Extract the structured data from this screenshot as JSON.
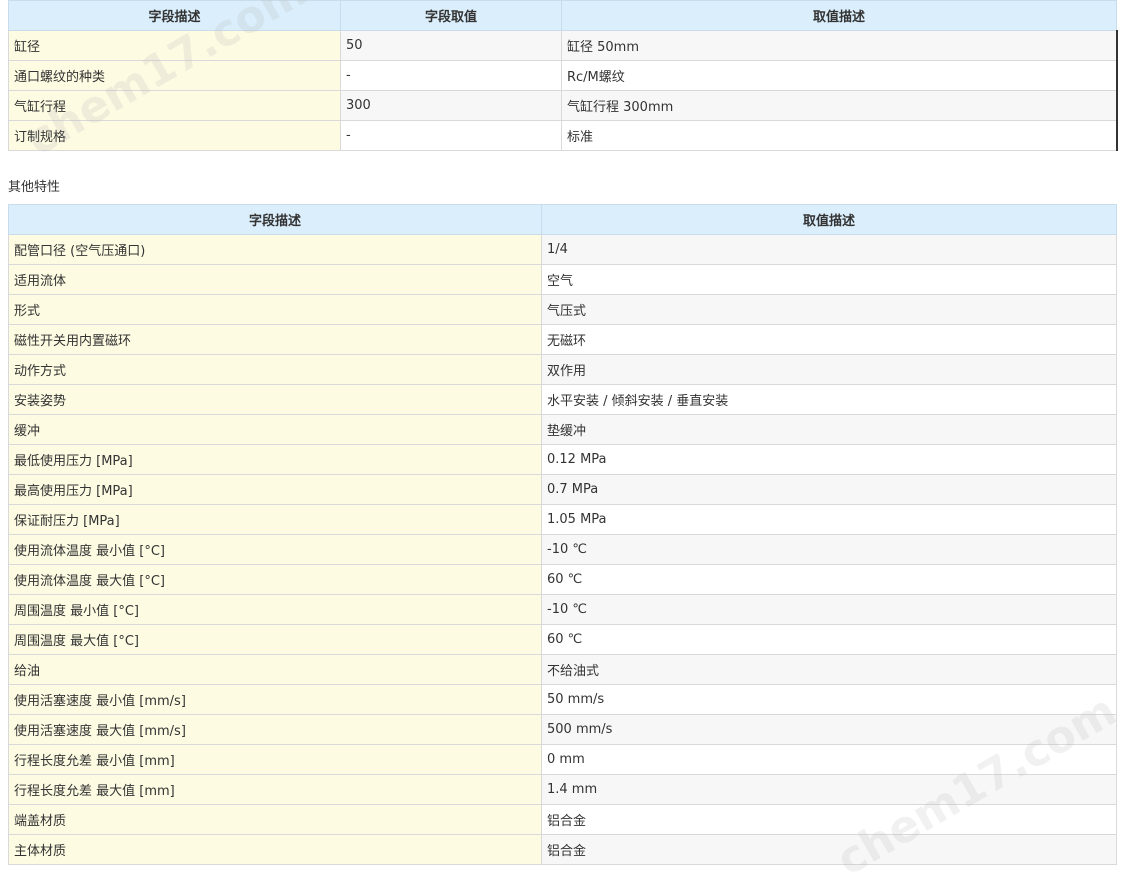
{
  "table1": {
    "headers": [
      "字段描述",
      "字段取值",
      "取值描述"
    ],
    "rows": [
      [
        "缸径",
        "50",
        "缸径 50mm"
      ],
      [
        "通口螺纹的种类",
        "-",
        "Rc/M螺纹"
      ],
      [
        "气缸行程",
        "300",
        "气缸行程 300mm"
      ],
      [
        "订制规格",
        "-",
        "标准"
      ]
    ]
  },
  "section_heading": "其他特性",
  "table2": {
    "headers": [
      "字段描述",
      "取值描述"
    ],
    "rows": [
      [
        "配管口径 (空气压通口)",
        "1/4"
      ],
      [
        "适用流体",
        "空气"
      ],
      [
        "形式",
        "气压式"
      ],
      [
        "磁性开关用内置磁环",
        "无磁环"
      ],
      [
        "动作方式",
        "双作用"
      ],
      [
        "安装姿势",
        "水平安装 / 倾斜安装 / 垂直安装"
      ],
      [
        "缓冲",
        "垫缓冲"
      ],
      [
        "最低使用压力 [MPa]",
        "0.12 MPa"
      ],
      [
        "最高使用压力 [MPa]",
        "0.7 MPa"
      ],
      [
        "保证耐压力 [MPa]",
        "1.05 MPa"
      ],
      [
        "使用流体温度 最小值 [°C]",
        "-10 ℃"
      ],
      [
        "使用流体温度 最大值 [°C]",
        "60 ℃"
      ],
      [
        "周围温度 最小值 [°C]",
        "-10 ℃"
      ],
      [
        "周围温度 最大值 [°C]",
        "60 ℃"
      ],
      [
        "给油",
        "不给油式"
      ],
      [
        "使用活塞速度 最小值 [mm/s]",
        "50 mm/s"
      ],
      [
        "使用活塞速度 最大值 [mm/s]",
        "500 mm/s"
      ],
      [
        "行程长度允差 最小值 [mm]",
        "0 mm"
      ],
      [
        "行程长度允差 最大值 [mm]",
        "1.4 mm"
      ],
      [
        "端盖材质",
        "铝合金"
      ],
      [
        "主体材质",
        "铝合金"
      ]
    ]
  },
  "watermark": "chem17.com"
}
